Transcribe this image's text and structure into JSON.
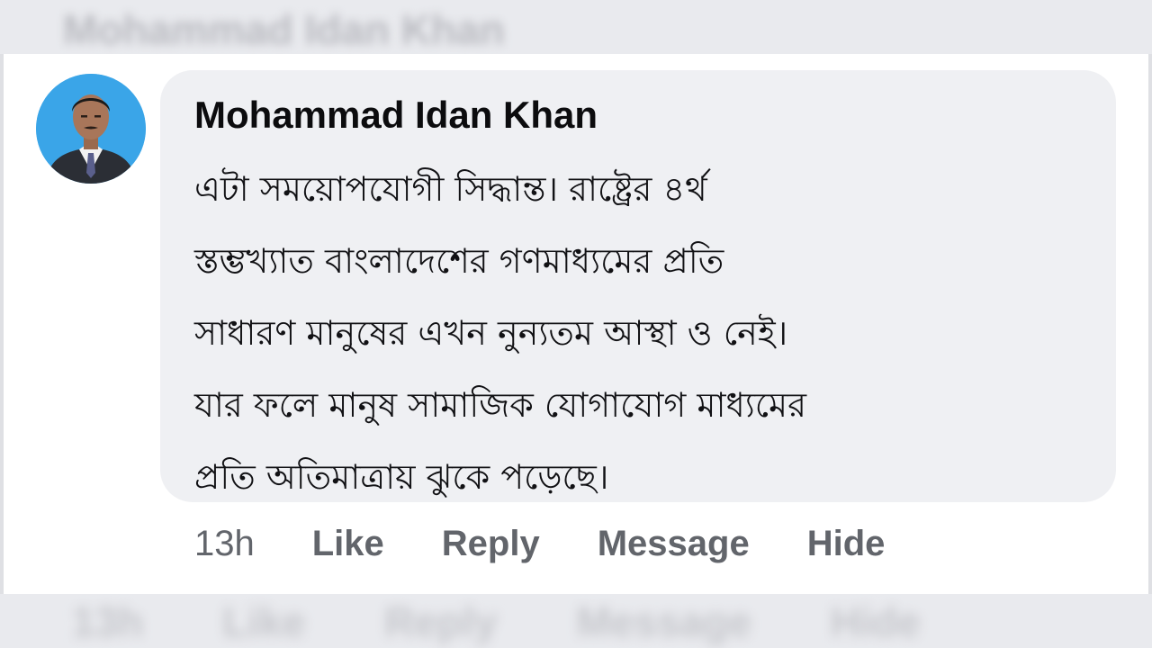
{
  "background": {
    "top_author_blurred": "Mohammad Idan Khan",
    "bottom_actions_blurred": [
      "13h",
      "Like",
      "Reply",
      "Message",
      "Hide"
    ]
  },
  "comment": {
    "author": "Mohammad Idan Khan",
    "avatar_icon": "profile-photo",
    "lines": [
      "এটা সময়োপযোগী  সিদ্ধান্ত। রাষ্ট্রের  ৪র্থ",
      "স্তম্ভখ্যাত  বাংলাদেশের  গণমাধ্যমের   প্রতি",
      "সাধারণ মানুষের  এখন নুন্যতম আস্থা ও নেই।",
      "যার ফলে মানুষ  সামাজিক যোগাযোগ মাধ্যমের",
      "প্রতি অতিমাত্রায়  ঝুকে  পড়েছে।"
    ],
    "timestamp": "13h",
    "actions": {
      "like": "Like",
      "reply": "Reply",
      "message": "Message",
      "hide": "Hide"
    }
  },
  "colors": {
    "bubble": "#eff0f3",
    "card": "#ffffff",
    "action_text": "#62656b",
    "avatar_bg": "#3aa5e8"
  }
}
